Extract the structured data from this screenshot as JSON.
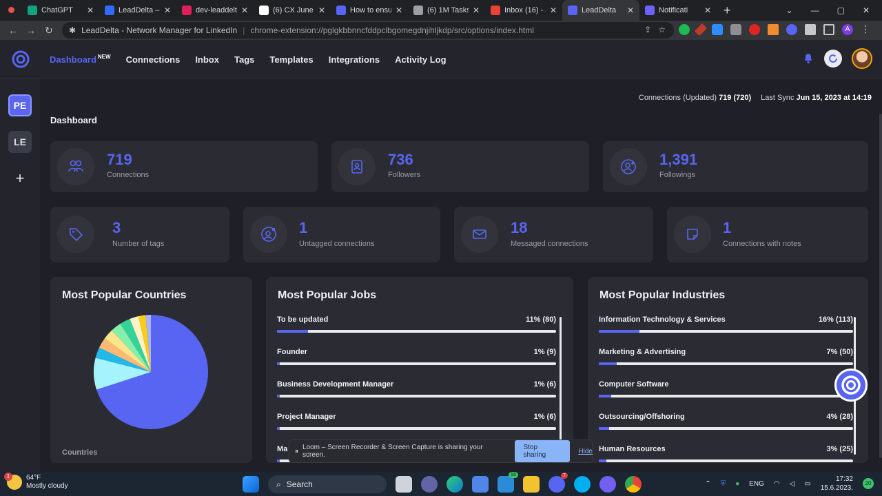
{
  "browser": {
    "tabs": [
      {
        "title": "ChatGPT",
        "color": "#10a37f"
      },
      {
        "title": "LeadDelta – C",
        "color": "#2f6bff"
      },
      {
        "title": "dev-leaddelta",
        "color": "#e01e5a"
      },
      {
        "title": "(6) CX June 2",
        "color": "#ffffff"
      },
      {
        "title": "How to ensur",
        "color": "#5865f2"
      },
      {
        "title": "(6) 1M Tasks",
        "color": "#9aa0a6"
      },
      {
        "title": "Inbox (16) - a",
        "color": "#ea4335"
      },
      {
        "title": "LeadDelta",
        "color": "#5865f2"
      },
      {
        "title": "Notificati",
        "color": "#6c63ff"
      }
    ],
    "omnibox_title": "LeadDelta - Network Manager for LinkedIn",
    "omnibox_url": "chrome-extension://pglgkbbnncfddpclbgomegdnjihljkdp/src/options/index.html",
    "profile_initial": "A"
  },
  "header": {
    "nav": [
      {
        "label": "Dashboard",
        "badge": "NEW"
      },
      {
        "label": "Connections"
      },
      {
        "label": "Inbox"
      },
      {
        "label": "Tags"
      },
      {
        "label": "Templates"
      },
      {
        "label": "Integrations"
      },
      {
        "label": "Activity Log"
      }
    ]
  },
  "sidebar": {
    "workspaces": [
      "PE",
      "LE"
    ],
    "add_label": "+"
  },
  "sync": {
    "connections_label": "Connections (Updated)",
    "connections_value": "719 (720)",
    "last_sync_label": "Last Sync",
    "last_sync_value": "Jun 15, 2023 at 14:19"
  },
  "page_title": "Dashboard",
  "stats_top": [
    {
      "value": "719",
      "label": "Connections",
      "icon": "users-icon"
    },
    {
      "value": "736",
      "label": "Followers",
      "icon": "contact-book-icon"
    },
    {
      "value": "1,391",
      "label": "Followings",
      "icon": "user-plus-icon"
    }
  ],
  "stats_bottom": [
    {
      "value": "3",
      "label": "Number of tags",
      "icon": "tag-icon"
    },
    {
      "value": "1",
      "label": "Untagged connections",
      "icon": "user-tag-icon"
    },
    {
      "value": "18",
      "label": "Messaged connections",
      "icon": "envelope-icon"
    },
    {
      "value": "1",
      "label": "Connections with notes",
      "icon": "note-icon"
    }
  ],
  "countries": {
    "title": "Most Popular Countries",
    "caption": "Countries"
  },
  "chart_data": {
    "type": "pie",
    "title": "Most Popular Countries",
    "values": [
      70,
      9,
      3,
      3,
      3,
      3,
      3,
      2.5,
      2,
      1.5
    ],
    "colors": [
      "#5865f2",
      "#a5f3fc",
      "#22b8e8",
      "#fdba74",
      "#fde68a",
      "#86efac",
      "#34d399",
      "#fef3c7",
      "#facc15",
      "#a5b4fc"
    ]
  },
  "jobs": {
    "title": "Most Popular Jobs",
    "items": [
      {
        "label": "To be updated",
        "value": "11% (80)",
        "pct": 11
      },
      {
        "label": "Founder",
        "value": "1% (9)",
        "pct": 1
      },
      {
        "label": "Business Development Manager",
        "value": "1% (6)",
        "pct": 1
      },
      {
        "label": "Project Manager",
        "value": "1% (6)",
        "pct": 1
      },
      {
        "label": "Ma",
        "value": "",
        "pct": 1
      }
    ]
  },
  "industries": {
    "title": "Most Popular Industries",
    "items": [
      {
        "label": "Information Technology & Services",
        "value": "16% (113)",
        "pct": 16
      },
      {
        "label": "Marketing & Advertising",
        "value": "7% (50)",
        "pct": 7
      },
      {
        "label": "Computer Software",
        "value": "5%",
        "pct": 5
      },
      {
        "label": "Outsourcing/Offshoring",
        "value": "4% (28)",
        "pct": 4
      },
      {
        "label": "Human Resources",
        "value": "3% (25)",
        "pct": 3
      }
    ]
  },
  "loom": {
    "message": "Loom – Screen Recorder & Screen Capture is sharing your screen.",
    "stop_label": "Stop sharing",
    "hide_label": "Hide"
  },
  "taskbar": {
    "weather_badge": "1",
    "temperature": "64°F",
    "weather_text": "Mostly cloudy",
    "search_label": "Search",
    "language": "ENG",
    "time": "17:32",
    "date": "15.6.2023.",
    "notifications": "20",
    "mail_badge": "56",
    "discord_badge": "7"
  }
}
